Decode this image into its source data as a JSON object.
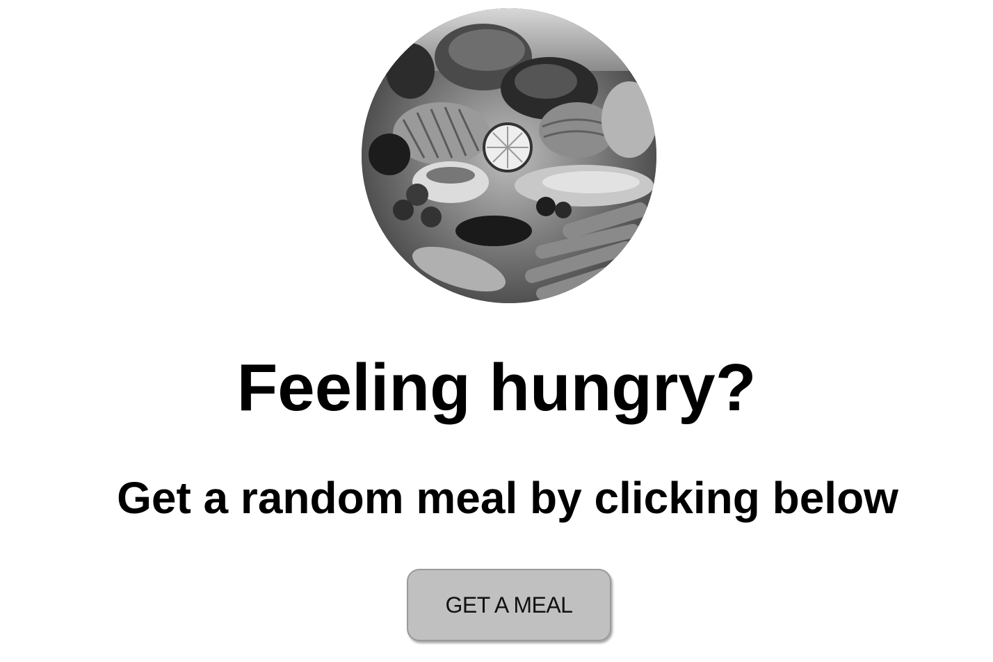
{
  "hero": {
    "image_alt": "Assorted food: bread, vegetables, fish and fruit (grayscale)"
  },
  "main": {
    "title": "Feeling hungry?",
    "subtitle": "Get a random meal by clicking below",
    "button_label": "GET A MEAL"
  },
  "colors": {
    "background": "#ffffff",
    "text": "#000000",
    "button_bg": "#c0c0c0",
    "button_border": "#9a9a9a"
  }
}
